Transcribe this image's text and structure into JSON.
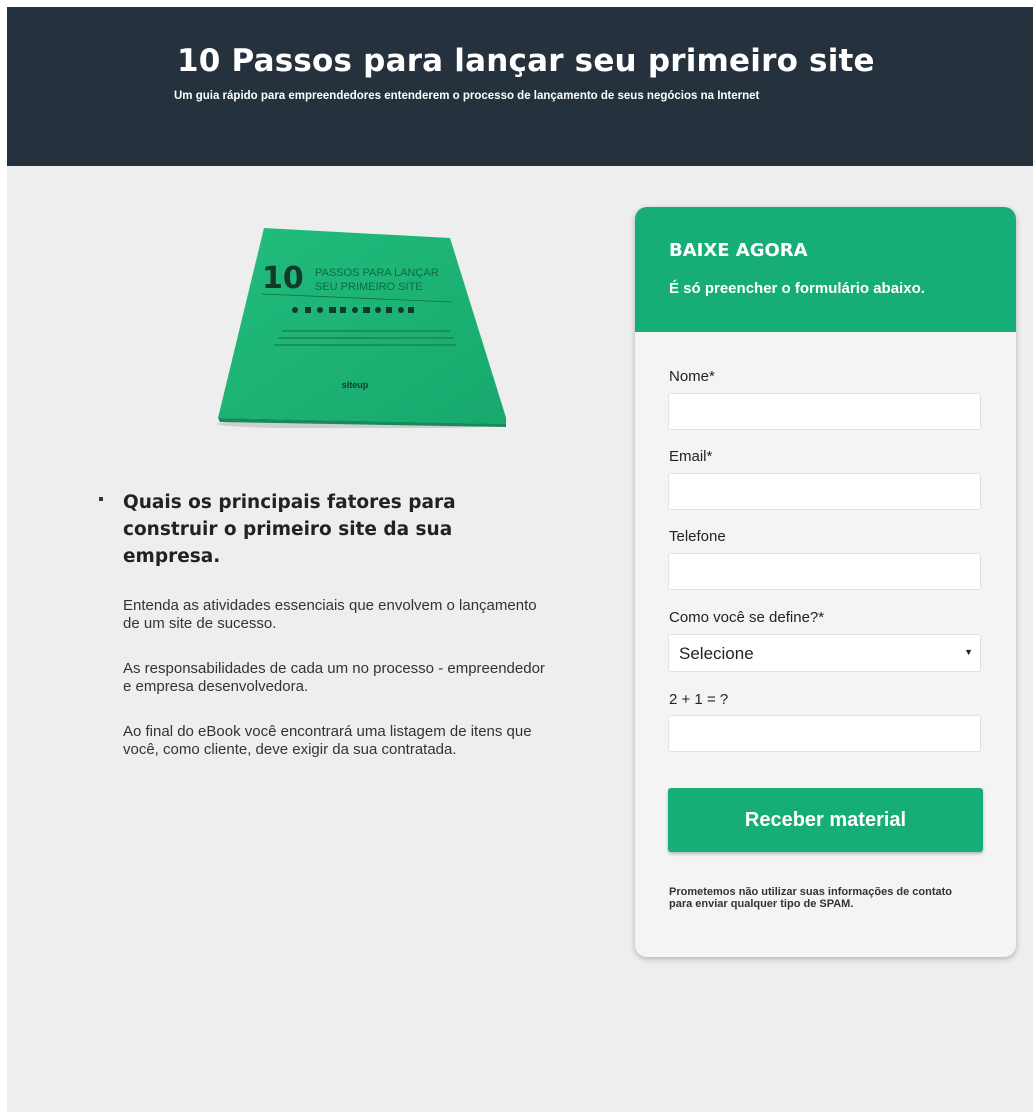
{
  "header": {
    "title": "10 Passos para lançar seu primeiro site",
    "subtitle": "Um guia rápido para empreendedores entenderem o processo de lançamento de seus negócios na Internet"
  },
  "ebook": {
    "number": "10",
    "title_line1": "PASSOS PARA LANÇAR",
    "title_line2": "SEU PRIMEIRO SITE",
    "brand": "siteup",
    "cover_color": "#1fb678"
  },
  "content": {
    "bullet_heading": "Quais os principais fatores para construir o primeiro site da sua empresa.",
    "paragraphs": [
      "Entenda as atividades essenciais que envolvem o lançamento de um site de sucesso.",
      "As responsabilidades de cada um no processo - empreendedor e empresa desenvolvedora.",
      "Ao final do eBook você encontrará uma listagem de itens que você, como cliente, deve exigir da sua contratada."
    ]
  },
  "form": {
    "heading": "BAIXE AGORA",
    "subheading": "É só preencher o formulário abaixo.",
    "fields": {
      "name_label": "Nome*",
      "email_label": "Email*",
      "phone_label": "Telefone",
      "define_label": "Como você se define?*",
      "define_value": "Selecione",
      "captcha_label": "2 + 1 = ?"
    },
    "submit_label": "Receber material",
    "disclaimer": "Prometemos não utilizar suas informações de contato para enviar qualquer tipo de SPAM."
  },
  "colors": {
    "header_bg": "#25313d",
    "accent": "#17ad77",
    "page_bg": "#eeeeee"
  }
}
